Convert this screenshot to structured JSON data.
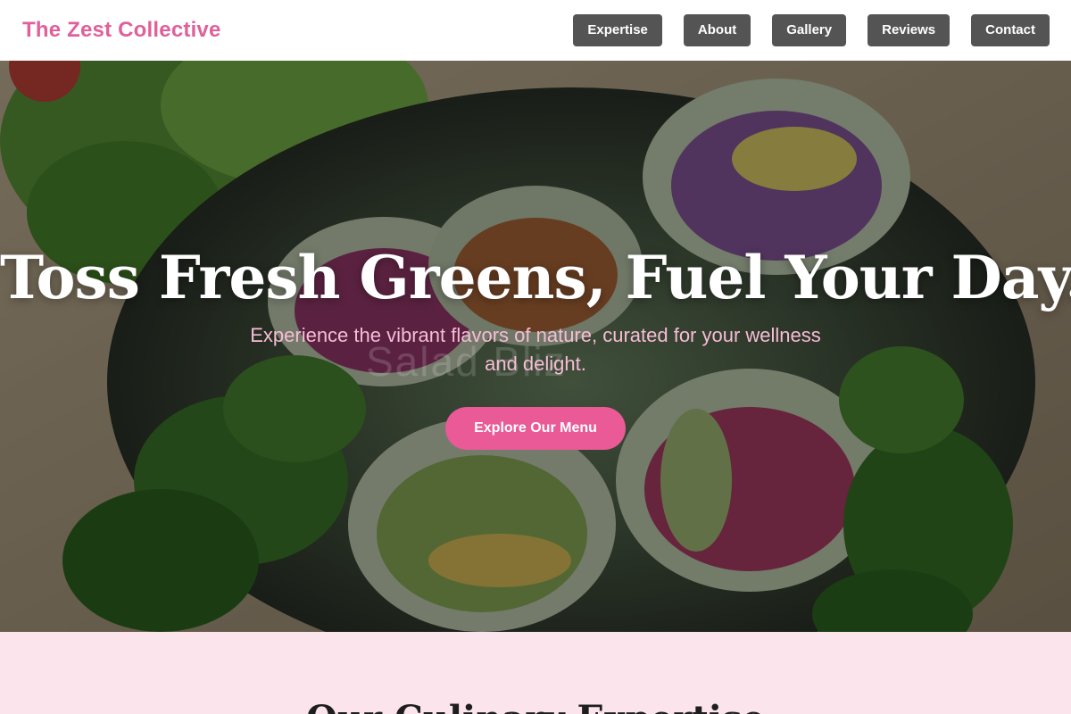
{
  "header": {
    "brand": "The Zest Collective",
    "nav": [
      {
        "label": "Expertise"
      },
      {
        "label": "About"
      },
      {
        "label": "Gallery"
      },
      {
        "label": "Reviews"
      },
      {
        "label": "Contact"
      }
    ]
  },
  "hero": {
    "title": "Toss Fresh Greens, Fuel Your Day.",
    "subtitle": "Experience the vibrant flavors of nature, curated for your wellness and delight.",
    "cta_label": "Explore Our Menu",
    "watermark": "Salad Bliz",
    "image": "fresh-spring-rolls-with-mint-photo"
  },
  "expertise": {
    "title": "Our Culinary Expertise"
  },
  "colors": {
    "brand": "#e0609a",
    "nav_bg": "#545454",
    "cta_bg": "#e95a97",
    "subtitle": "#f7bcd6",
    "section_bg": "#fbe4ec"
  }
}
